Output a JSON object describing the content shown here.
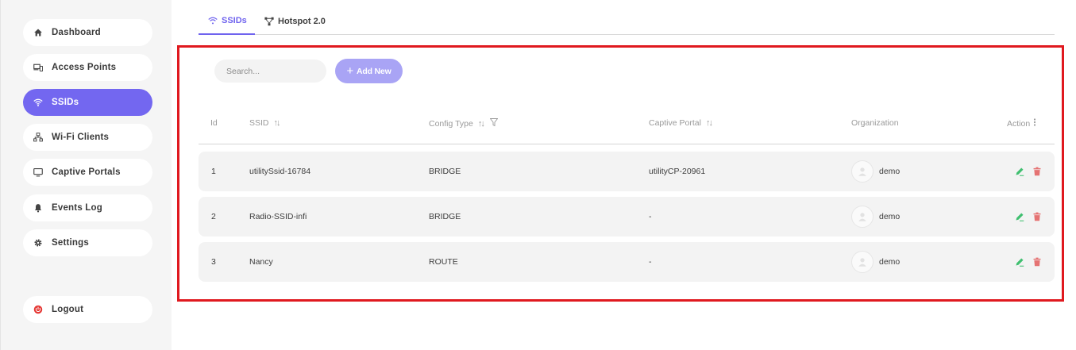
{
  "sidebar": {
    "items": [
      {
        "label": "Dashboard",
        "icon": "home-icon"
      },
      {
        "label": "Access Points",
        "icon": "devices-icon"
      },
      {
        "label": "SSIDs",
        "icon": "wifi-icon",
        "active": true
      },
      {
        "label": "Wi-Fi Clients",
        "icon": "network-icon"
      },
      {
        "label": "Captive Portals",
        "icon": "monitor-icon"
      },
      {
        "label": "Events Log",
        "icon": "bell-icon"
      },
      {
        "label": "Settings",
        "icon": "gear-icon"
      }
    ],
    "logout": {
      "label": "Logout",
      "icon": "power-icon"
    }
  },
  "tabs": [
    {
      "label": "SSIDs",
      "icon": "wifi-icon",
      "active": true
    },
    {
      "label": "Hotspot 2.0",
      "icon": "hotspot-icon",
      "active": false
    }
  ],
  "toolbar": {
    "search_placeholder": "Search...",
    "add_label": "Add New"
  },
  "table": {
    "columns": [
      "Id",
      "SSID",
      "Config Type",
      "Captive Portal",
      "Organization",
      "Action"
    ],
    "rows": [
      {
        "id": "1",
        "ssid": "utilitySsid-16784",
        "config_type": "BRIDGE",
        "captive_portal": "utilityCP-20961",
        "organization": "demo"
      },
      {
        "id": "2",
        "ssid": "Radio-SSID-infi",
        "config_type": "BRIDGE",
        "captive_portal": "-",
        "organization": "demo"
      },
      {
        "id": "3",
        "ssid": "Nancy",
        "config_type": "ROUTE",
        "captive_portal": "-",
        "organization": "demo"
      }
    ]
  },
  "colors": {
    "accent": "#7367f0",
    "add_button": "#a9a4f5",
    "highlight_border": "#e0191f",
    "edit_icon": "#3fbf6f",
    "delete_icon": "#e57373"
  }
}
